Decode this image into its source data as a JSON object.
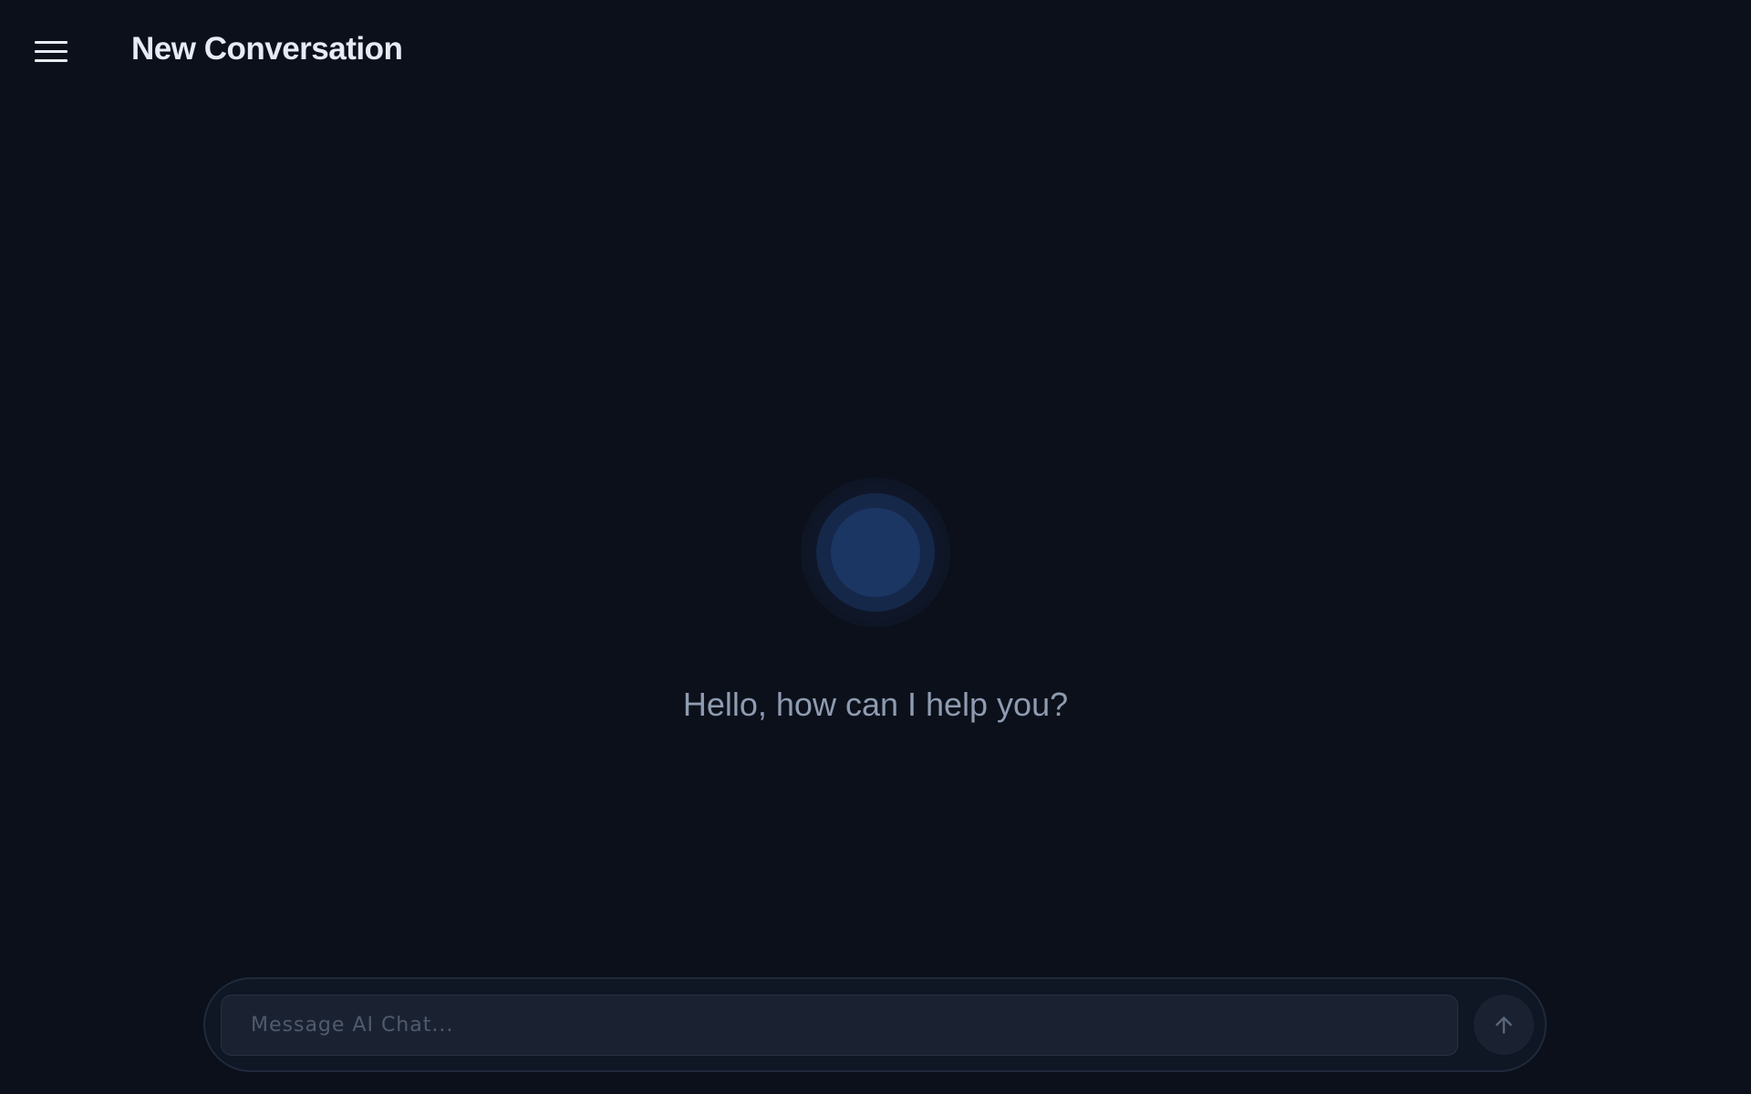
{
  "header": {
    "menu_icon": "hamburger-menu-icon",
    "title": "New Conversation"
  },
  "main": {
    "assistant_icon": "orb-icon",
    "greeting": "Hello, how can I help you?"
  },
  "composer": {
    "placeholder": "Message AI Chat...",
    "value": "",
    "send_icon": "arrow-up-icon"
  },
  "colors": {
    "background": "#0b101b",
    "title_text": "#e6ebf5",
    "greeting_text": "#8f9bb0",
    "orb_accent": "#1c3663",
    "input_background": "#1a2232",
    "placeholder_text": "#4f5b6d"
  }
}
